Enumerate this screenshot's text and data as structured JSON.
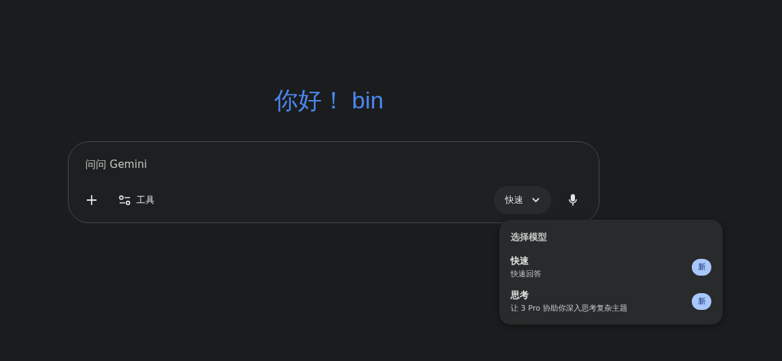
{
  "greeting": "你好！ bin",
  "prompt": {
    "placeholder": "问问 Gemini"
  },
  "tools_button": {
    "label": "工具"
  },
  "model_button": {
    "label": "快速",
    "expanded": true
  },
  "model_menu": {
    "title": "选择模型",
    "items": [
      {
        "name": "快速",
        "description": "快速回答",
        "badge": "新"
      },
      {
        "name": "思考",
        "description": "让 3 Pro 协助你深入思考复杂主题",
        "badge": "新"
      }
    ]
  }
}
